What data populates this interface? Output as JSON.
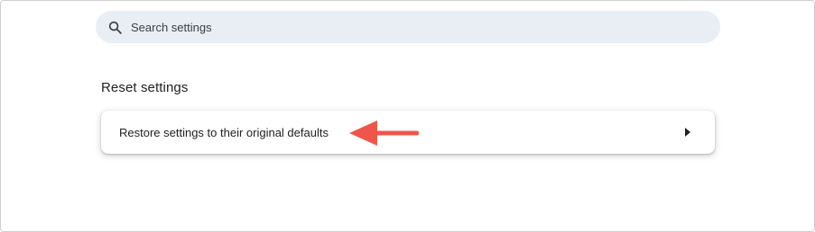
{
  "search": {
    "placeholder": "Search settings",
    "icon": "search-icon"
  },
  "section": {
    "title": "Reset settings"
  },
  "reset_card": {
    "row_label": "Restore settings to their original defaults",
    "arrow_icon": "triangle-right-icon"
  },
  "annotation": {
    "color": "#f0554a"
  },
  "colors": {
    "search_bg": "#e9edf4",
    "text": "#202124"
  }
}
